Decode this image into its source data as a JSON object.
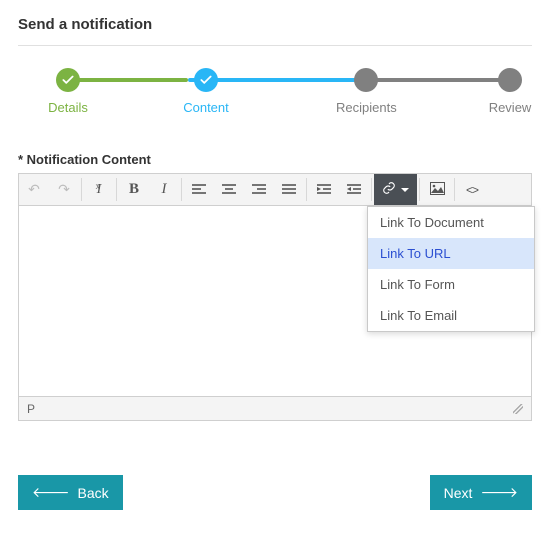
{
  "page": {
    "title": "Send a notification"
  },
  "stepper": {
    "steps": [
      {
        "label": "Details"
      },
      {
        "label": "Content"
      },
      {
        "label": "Recipients"
      },
      {
        "label": "Review"
      }
    ]
  },
  "field_label": "* Notification Content",
  "toolbar": {
    "bold_glyph": "B",
    "italic_glyph": "I",
    "undo_glyph": "↶",
    "redo_glyph": "↷",
    "source_glyph": "<>"
  },
  "link_menu": {
    "items": [
      {
        "label": "Link To Document"
      },
      {
        "label": "Link To URL"
      },
      {
        "label": "Link To Form"
      },
      {
        "label": "Link To Email"
      }
    ]
  },
  "editor_footer": {
    "path": "P"
  },
  "buttons": {
    "back": "Back",
    "next": "Next"
  }
}
